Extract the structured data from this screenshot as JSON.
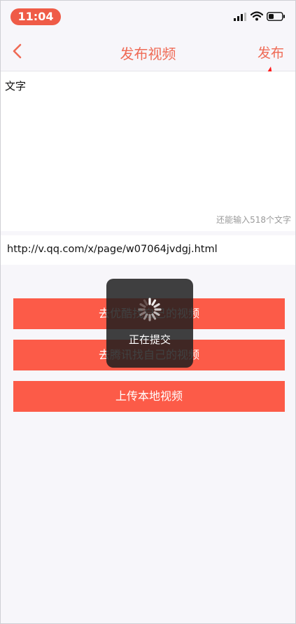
{
  "status_bar": {
    "time": "11:04",
    "signal": "signal-icon",
    "wifi": "wifi-icon",
    "battery": "battery-icon"
  },
  "nav": {
    "back": "chevron-left-icon",
    "title": "发布视频",
    "publish_label": "发布"
  },
  "text_area": {
    "value": "文字",
    "counter": "还能输入518个文字"
  },
  "url_field": {
    "value": "http://v.qq.com/x/page/w07064jvdgj.html"
  },
  "buttons": {
    "youku": "去优酷找自己的视频",
    "tencent": "去腾讯找自己的视频",
    "upload": "上传本地视频"
  },
  "loading": {
    "text": "正在提交",
    "icon": "spinner-icon"
  },
  "colors": {
    "accent": "#ef6a55",
    "button": "#fc5b48",
    "time_pill": "#ef5b47",
    "annotation": "#ff1a1a"
  }
}
